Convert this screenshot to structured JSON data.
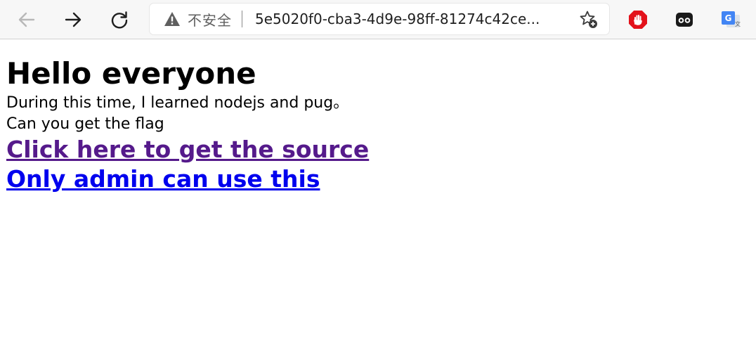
{
  "browser": {
    "security_label": "不安全",
    "url": "5e5020f0-cba3-4d9e-98ff-81274c42ce..."
  },
  "page": {
    "heading": "Hello everyone",
    "paragraphs": [
      "During this time, I learned nodejs and pug。",
      "Can you get the flag"
    ],
    "links": [
      {
        "label": "Click here to get the source",
        "color": "#551a8b"
      },
      {
        "label": "Only admin can use this",
        "color": "#0000ee"
      }
    ]
  },
  "icons": {
    "back": "back-arrow-icon",
    "forward": "forward-arrow-icon",
    "reload": "reload-icon",
    "warning": "warning-icon",
    "favorite": "add-favorite-icon",
    "ext_block": "adblock-hand-icon",
    "ext_mask": "mask-extension-icon",
    "ext_translate": "google-translate-icon"
  },
  "colors": {
    "visited_link": "#551a8b",
    "link": "#0000ee",
    "adblock_red": "#e3121b"
  }
}
